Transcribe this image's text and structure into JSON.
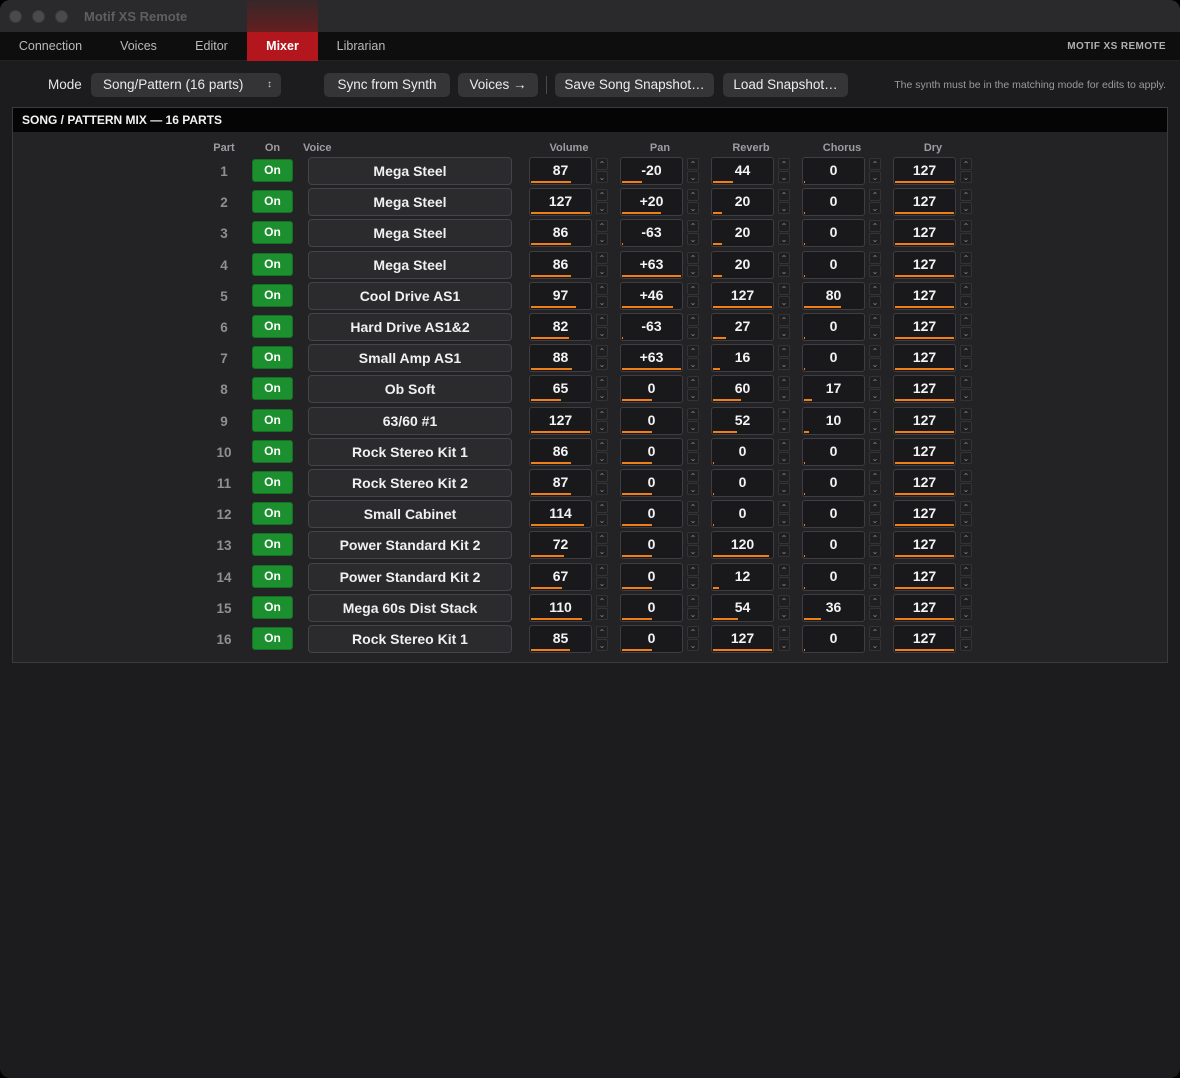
{
  "window": {
    "title": "Motif XS Remote"
  },
  "tabs": [
    {
      "label": "Connection",
      "active": false
    },
    {
      "label": "Voices",
      "active": false
    },
    {
      "label": "Editor",
      "active": false
    },
    {
      "label": "Mixer",
      "active": true
    },
    {
      "label": "Librarian",
      "active": false
    }
  ],
  "brand": "MOTIF XS REMOTE",
  "toolbar": {
    "mode_label": "Mode",
    "mode_value": "Song/Pattern (16 parts)",
    "sync_label": "Sync from Synth",
    "voices_label": "Voices →",
    "save_label": "Save Song Snapshot…",
    "load_label": "Load Snapshot…",
    "hint": "The synth must be in the matching mode for edits to apply."
  },
  "panel": {
    "title": "SONG / PATTERN MIX — 16 PARTS"
  },
  "columns": {
    "part": "Part",
    "on": "On",
    "voice": "Voice",
    "volume": "Volume",
    "pan": "Pan",
    "reverb": "Reverb",
    "chorus": "Chorus",
    "dry": "Dry"
  },
  "colors": {
    "accent": "#b3161c",
    "on_green": "#1c8f2e",
    "meter": "#f07f1a"
  },
  "parts": [
    {
      "part": "1",
      "on": "On",
      "voice": "Mega Steel",
      "volume": "87",
      "pan": "-20",
      "reverb": "44",
      "chorus": "0",
      "dry": "127"
    },
    {
      "part": "2",
      "on": "On",
      "voice": "Mega Steel",
      "volume": "127",
      "pan": "+20",
      "reverb": "20",
      "chorus": "0",
      "dry": "127"
    },
    {
      "part": "3",
      "on": "On",
      "voice": "Mega Steel",
      "volume": "86",
      "pan": "-63",
      "reverb": "20",
      "chorus": "0",
      "dry": "127"
    },
    {
      "part": "4",
      "on": "On",
      "voice": "Mega Steel",
      "volume": "86",
      "pan": "+63",
      "reverb": "20",
      "chorus": "0",
      "dry": "127"
    },
    {
      "part": "5",
      "on": "On",
      "voice": "Cool Drive AS1",
      "volume": "97",
      "pan": "+46",
      "reverb": "127",
      "chorus": "80",
      "dry": "127"
    },
    {
      "part": "6",
      "on": "On",
      "voice": "Hard Drive AS1&2",
      "volume": "82",
      "pan": "-63",
      "reverb": "27",
      "chorus": "0",
      "dry": "127"
    },
    {
      "part": "7",
      "on": "On",
      "voice": "Small Amp AS1",
      "volume": "88",
      "pan": "+63",
      "reverb": "16",
      "chorus": "0",
      "dry": "127"
    },
    {
      "part": "8",
      "on": "On",
      "voice": "Ob Soft",
      "volume": "65",
      "pan": "0",
      "reverb": "60",
      "chorus": "17",
      "dry": "127"
    },
    {
      "part": "9",
      "on": "On",
      "voice": "63/60 #1",
      "volume": "127",
      "pan": "0",
      "reverb": "52",
      "chorus": "10",
      "dry": "127"
    },
    {
      "part": "10",
      "on": "On",
      "voice": "Rock Stereo Kit 1",
      "volume": "86",
      "pan": "0",
      "reverb": "0",
      "chorus": "0",
      "dry": "127"
    },
    {
      "part": "11",
      "on": "On",
      "voice": "Rock Stereo Kit 2",
      "volume": "87",
      "pan": "0",
      "reverb": "0",
      "chorus": "0",
      "dry": "127"
    },
    {
      "part": "12",
      "on": "On",
      "voice": "Small Cabinet",
      "volume": "114",
      "pan": "0",
      "reverb": "0",
      "chorus": "0",
      "dry": "127"
    },
    {
      "part": "13",
      "on": "On",
      "voice": "Power Standard Kit 2",
      "volume": "72",
      "pan": "0",
      "reverb": "120",
      "chorus": "0",
      "dry": "127"
    },
    {
      "part": "14",
      "on": "On",
      "voice": "Power Standard Kit 2",
      "volume": "67",
      "pan": "0",
      "reverb": "12",
      "chorus": "0",
      "dry": "127"
    },
    {
      "part": "15",
      "on": "On",
      "voice": "Mega 60s Dist Stack",
      "volume": "110",
      "pan": "0",
      "reverb": "54",
      "chorus": "36",
      "dry": "127"
    },
    {
      "part": "16",
      "on": "On",
      "voice": "Rock Stereo Kit 1",
      "volume": "85",
      "pan": "0",
      "reverb": "127",
      "chorus": "0",
      "dry": "127"
    }
  ]
}
